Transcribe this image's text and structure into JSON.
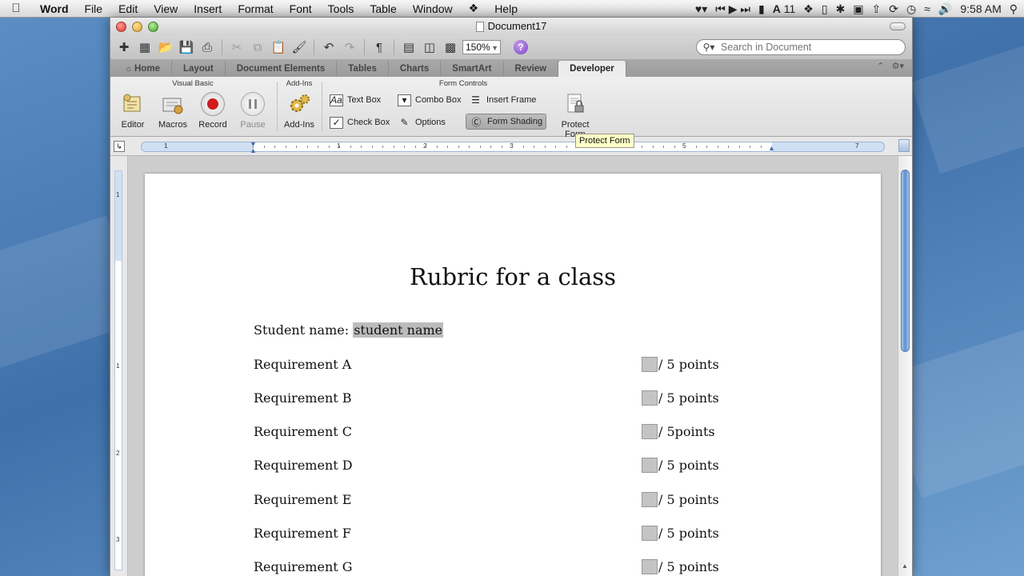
{
  "menubar": {
    "apple": "",
    "items": [
      "Word",
      "File",
      "Edit",
      "View",
      "Insert",
      "Format",
      "Font",
      "Tools",
      "Table",
      "Window",
      "",
      "Help"
    ],
    "status": {
      "font_size": "11",
      "clock": "9:58 AM"
    }
  },
  "window": {
    "title": "Document17",
    "zoom": "150%",
    "search_placeholder": "Search in Document"
  },
  "tabs": [
    "Home",
    "Layout",
    "Document Elements",
    "Tables",
    "Charts",
    "SmartArt",
    "Review",
    "Developer"
  ],
  "ribbon": {
    "groups": {
      "visual_basic": "Visual Basic",
      "add_ins": "Add-Ins",
      "form_controls": "Form Controls"
    },
    "buttons": {
      "editor": "Editor",
      "macros": "Macros",
      "record": "Record",
      "pause": "Pause",
      "add_ins": "Add-Ins",
      "text_box": "Text Box",
      "check_box": "Check Box",
      "combo_box": "Combo Box",
      "options": "Options",
      "insert_frame": "Insert Frame",
      "form_shading": "Form Shading",
      "protect_form": "Protect Form"
    },
    "tooltip": "Protect Form"
  },
  "ruler": {
    "numbers": [
      "1",
      "1",
      "2",
      "3",
      "5",
      "7"
    ]
  },
  "vruler": {
    "numbers": [
      "1",
      "1",
      "2",
      "3"
    ]
  },
  "document": {
    "title": "Rubric for a class",
    "student_label": "Student name: ",
    "student_field": "student name",
    "requirements": [
      {
        "label": "Requirement A",
        "points": "/ 5 points"
      },
      {
        "label": "Requirement B",
        "points": "/ 5 points"
      },
      {
        "label": "Requirement C",
        "points": "/ 5points"
      },
      {
        "label": "Requirement D",
        "points": "/ 5 points"
      },
      {
        "label": "Requirement E",
        "points": "/ 5 points"
      },
      {
        "label": "Requirement F",
        "points": "/ 5 points"
      },
      {
        "label": "Requirement G",
        "points": "/ 5 points"
      }
    ]
  },
  "colors": {
    "tab_active_bg": "#ececec",
    "record_red": "#cf1c1c",
    "form_field_grey": "#c4c4c4",
    "tooltip_bg": "#ffffc6"
  }
}
